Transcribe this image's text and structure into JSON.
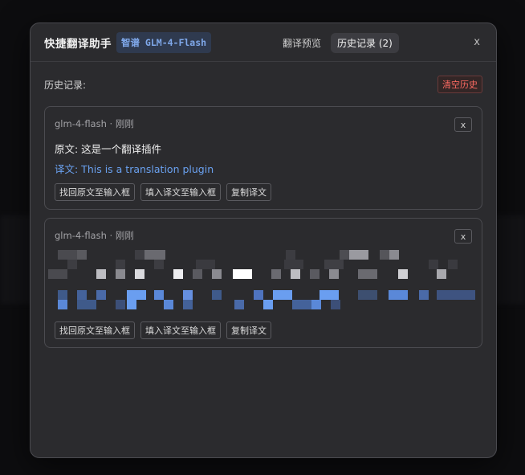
{
  "header": {
    "title": "快捷翻译助手",
    "model_badge": "智谱 GLM-4-Flash",
    "tabs": [
      {
        "label": "翻译预览",
        "active": false
      },
      {
        "label": "历史记录 (2)",
        "active": true
      }
    ],
    "close_label": "x"
  },
  "history": {
    "label": "历史记录:",
    "clear_label": "清空历史",
    "items": [
      {
        "meta": "glm-4-flash · 刚刚",
        "original": "原文: 这是一个翻译插件",
        "translation": "译文: This is a translation plugin",
        "close_label": "x",
        "actions": [
          "找回原文至输入框",
          "填入译文至输入框",
          "复制译文"
        ]
      },
      {
        "meta": "glm-4-flash · 刚刚",
        "close_label": "x",
        "actions": [
          "找回原文至输入框",
          "填入译文至输入框",
          "复制译文"
        ]
      }
    ]
  },
  "colors": {
    "accent_blue": "#6aa1f0",
    "danger_red": "#ff6b63",
    "dialog_bg": "#2b2b2e"
  }
}
